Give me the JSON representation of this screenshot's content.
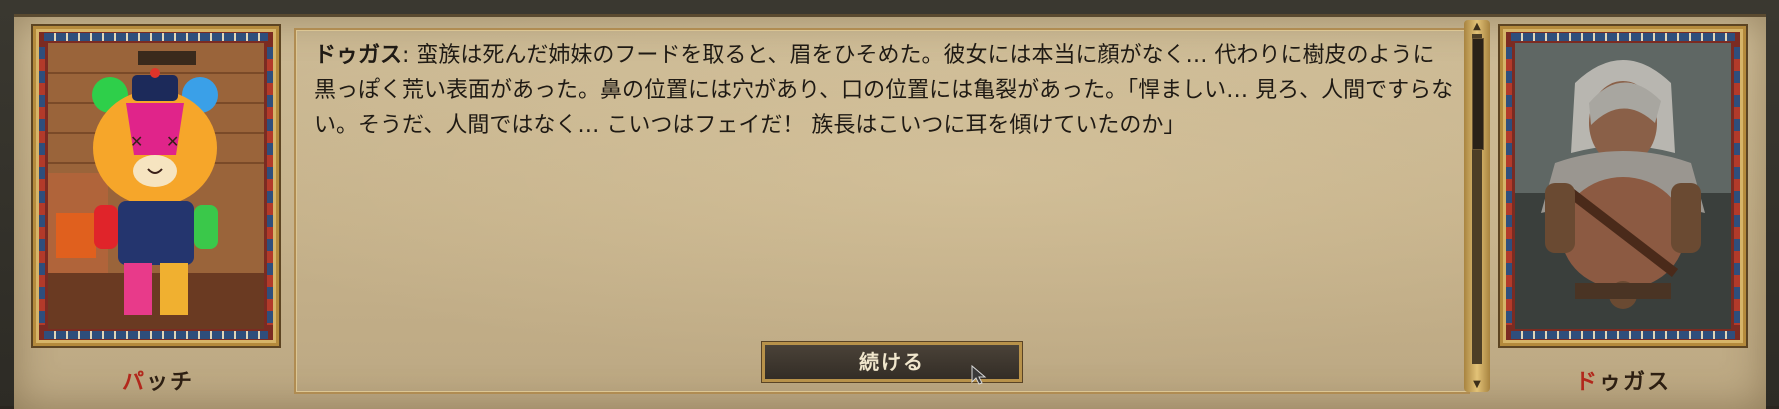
{
  "dialogue": {
    "speaker": "ドゥガス",
    "text": ": 蛮族は死んだ姉妹のフードを取ると、眉をひそめた。彼女には本当に顔がなく… 代わりに樹皮のように黒っぽく荒い表面があった。鼻の位置には穴があり、口の位置には亀裂があった。「悍ましい… 見ろ、人間ですらない。そうだ、人間ではなく… こいつはフェイだ！ 族長はこいつに耳を傾けていたのか」"
  },
  "left_portrait": {
    "name_first": "パ",
    "name_rest": "ッチ",
    "icon": "bear-villager-portrait"
  },
  "right_portrait": {
    "name_first": "ド",
    "name_rest": "ゥガス",
    "icon": "barbarian-warrior-portrait"
  },
  "continue_button": {
    "label": "続ける"
  },
  "colors": {
    "parchment": "#c6b28b",
    "gold_trim": "#b8924a",
    "name_accent": "#b2281c",
    "button_bg": "#3a332b"
  }
}
